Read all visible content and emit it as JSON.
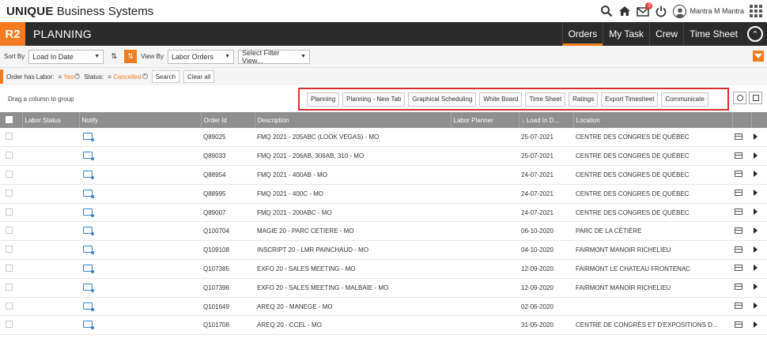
{
  "header": {
    "brand_bold": "UNIQUE",
    "brand_rest": "Business Systems",
    "notifications_count": "3",
    "user_name": "Mantra M Mantra"
  },
  "nav": {
    "logo": "R2",
    "page_title": "PLANNING",
    "tabs": [
      "Orders",
      "My Task",
      "Crew",
      "Time Sheet"
    ],
    "active_tab": "Orders"
  },
  "filters": {
    "sort_by_label": "Sort By",
    "sort_by_value": "Load In Date",
    "view_by_label": "View By",
    "view_by_value": "Labor Orders",
    "filter_view_value": "Select Filter View..."
  },
  "status": {
    "order_has_labor_label": "Order has Labor:",
    "order_has_labor_value": "Yes",
    "status_label": "Status:",
    "status_value": "Cancelled",
    "search_label": "Search",
    "clear_label": "Clear all"
  },
  "toolbar": {
    "group_hint": "Drag a column to group",
    "actions": [
      "Planning",
      "Planning - New Tab",
      "Graphical Scheduling",
      "White Board",
      "Time Sheet",
      "Ratings",
      "Export Timesheet",
      "Communicate"
    ]
  },
  "table": {
    "columns": [
      "Labor Status",
      "Notify",
      "Order Id",
      "Description",
      "Labor Planner",
      "Load In D...",
      "Location"
    ],
    "rows": [
      {
        "order_id": "Q89025",
        "description": "FMQ 2021 - 205ABC (LOOK VEGAS) - MO",
        "planner": "",
        "load_in": "25-07-2021",
        "location": "CENTRE DES CONGRES DE QUÉBEC"
      },
      {
        "order_id": "Q89033",
        "description": "FMQ 2021 - 206AB, 306AB, 310 - MO",
        "planner": "",
        "load_in": "25-07-2021",
        "location": "CENTRE DES CONGRES DE QUÉBEC"
      },
      {
        "order_id": "Q88954",
        "description": "FMQ 2021 - 400AB - MO",
        "planner": "",
        "load_in": "24-07-2021",
        "location": "CENTRE DES CONGRES DE QUÉBEC"
      },
      {
        "order_id": "Q88995",
        "description": "FMQ 2021 - 400C - MO",
        "planner": "",
        "load_in": "24-07-2021",
        "location": "CENTRE DES CONGRES DE QUÉBEC"
      },
      {
        "order_id": "Q89007",
        "description": "FMQ 2021 - 200ABC - MO",
        "planner": "",
        "load_in": "24-07-2021",
        "location": "CENTRE DES CONGRES DE QUÉBEC"
      },
      {
        "order_id": "Q100704",
        "description": "MAGIE 20 - PARC CETIERE - MO",
        "planner": "",
        "load_in": "06-10-2020",
        "location": "PARC DE LA CÉTIÈRE"
      },
      {
        "order_id": "Q109108",
        "description": "INSCRIPT 20 - LMR PAINCHAUD - MO",
        "planner": "",
        "load_in": "04-10-2020",
        "location": "FAIRMONT MANOIR RICHELIEU"
      },
      {
        "order_id": "Q107385",
        "description": "EXFO 20 - SALES MEETING - MO",
        "planner": "",
        "load_in": "12-09-2020",
        "location": "FAIRMONT LE CHATEAU FRONTENAC"
      },
      {
        "order_id": "Q107396",
        "description": "EXFO 20 - SALES MEETING - MALBAIE - MO",
        "planner": "",
        "load_in": "12-09-2020",
        "location": "FAIRMONT MANOIR RICHELIEU"
      },
      {
        "order_id": "Q101649",
        "description": "AREQ 20 - MANEGE - MO",
        "planner": "",
        "load_in": "02-06-2020",
        "location": ""
      },
      {
        "order_id": "Q101708",
        "description": "AREQ 20 - CCEL - MO",
        "planner": "",
        "load_in": "31-05-2020",
        "location": "CENTRE DE CONGRÈS ET D'EXPOSITIONS D..."
      }
    ]
  },
  "colors": {
    "accent": "#f47c20",
    "navbar": "#2b2b2b",
    "highlight_box": "#d63033",
    "table_header": "#8f8f8f"
  }
}
